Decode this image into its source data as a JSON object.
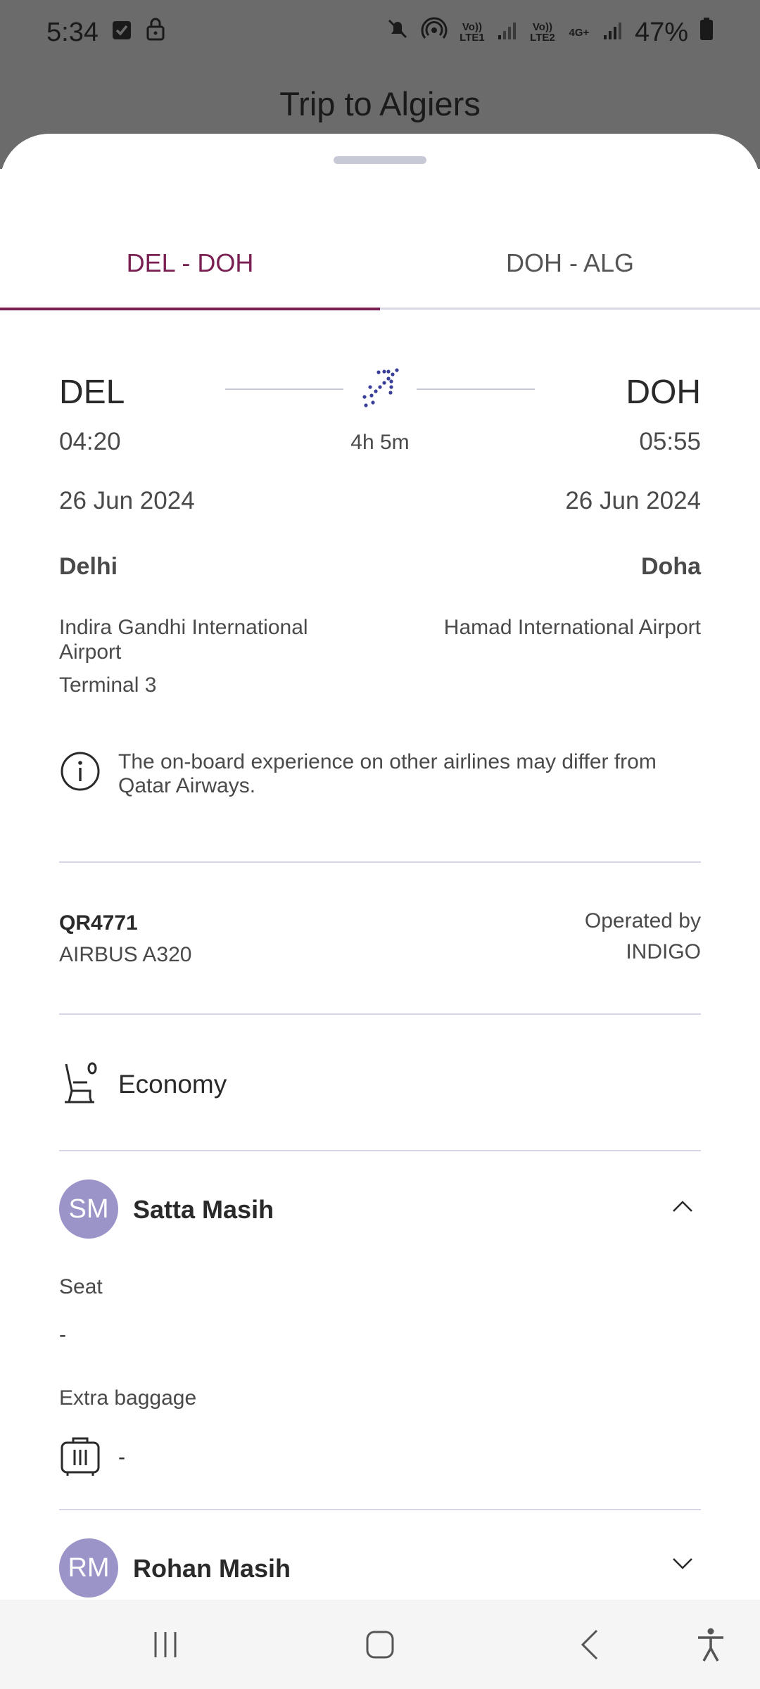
{
  "status_bar": {
    "time": "5:34",
    "battery": "47%",
    "sim1_label": "Vo)) LTE1",
    "sim2_label": "Vo)) LTE2",
    "net_label": "4G+",
    "icons": [
      "checkbox-icon",
      "lock-icon",
      "mute-icon",
      "hotspot-icon",
      "signal-icon",
      "battery-icon"
    ]
  },
  "header": {
    "title": "Trip to Algiers"
  },
  "tabs": [
    {
      "label": "DEL - DOH",
      "active": true
    },
    {
      "label": "DOH - ALG",
      "active": false
    }
  ],
  "segment": {
    "origin": {
      "code": "DEL",
      "time": "04:20",
      "date": "26 Jun 2024",
      "city": "Delhi",
      "airport": "Indira Gandhi International Airport",
      "terminal": "Terminal 3"
    },
    "destination": {
      "code": "DOH",
      "time": "05:55",
      "date": "26 Jun 2024",
      "city": "Doha",
      "airport": "Hamad International Airport"
    },
    "duration": "4h 5m",
    "notice": "The on-board experience on other airlines may differ from Qatar Airways.",
    "flight_number": "QR4771",
    "aircraft": "AIRBUS A320",
    "operated_by_label": "Operated by",
    "operator": "INDIGO",
    "cabin": "Economy"
  },
  "passengers": [
    {
      "initials": "SM",
      "name": "Satta Masih",
      "expanded": true,
      "seat_label": "Seat",
      "seat_value": "-",
      "baggage_label": "Extra baggage",
      "baggage_value": "-"
    },
    {
      "initials": "RM",
      "name": "Rohan Masih",
      "expanded": false
    }
  ],
  "colors": {
    "accent": "#7a1f52",
    "avatar": "#9b94c8",
    "plane_icon": "#3a3f9a",
    "divider": "#d6d6e4"
  }
}
